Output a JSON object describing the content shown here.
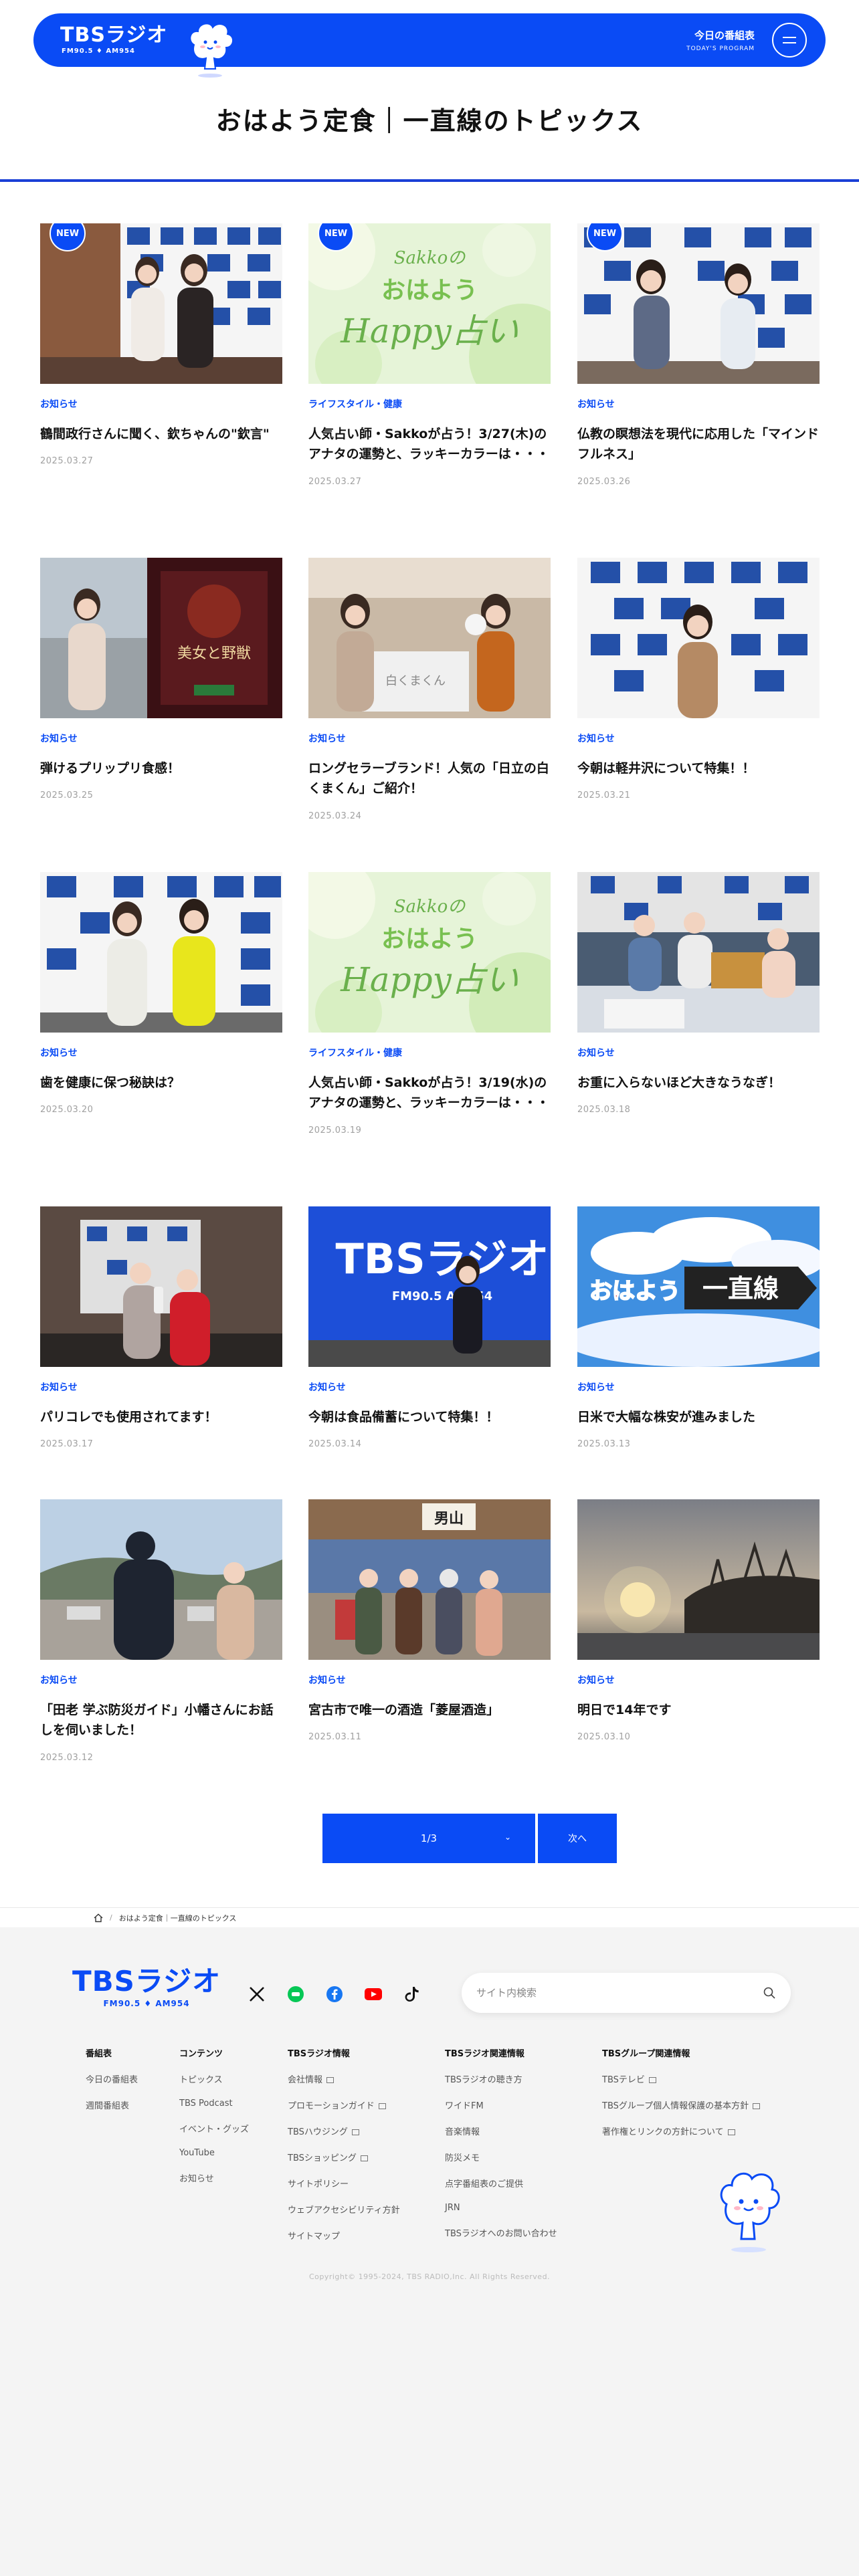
{
  "header": {
    "logo_text": "TBSラジオ",
    "logo_sub": "FM90.5 ♦ AM954",
    "program_label": "今日の番組表",
    "program_sub": "TODAY'S PROGRAM",
    "menu_icon": "hamburger-menu-icon"
  },
  "page": {
    "title": "おはよう定食｜一直線のトピックス"
  },
  "cards": [
    {
      "category": "お知らせ",
      "title": "鶴間政行さんに聞く、欽ちゃんの\"欽言\"",
      "date": "2025.03.27",
      "badge": "NEW"
    },
    {
      "category": "ライフスタイル・健康",
      "title": "人気占い師・Sakkoが占う！3/27(木)のアナタの運勢と、ラッキーカラーは・・・",
      "date": "2025.03.27",
      "badge": "NEW",
      "image_text_top": "Sakkoの",
      "image_text_mid": "おはよう",
      "image_text_bottom": "Happy占い"
    },
    {
      "category": "お知らせ",
      "title": "仏教の瞑想法を現代に応用した「マインドフルネス」",
      "date": "2025.03.26",
      "badge": "NEW"
    },
    {
      "category": "お知らせ",
      "title": "弾けるプリップリ食感！",
      "date": "2025.03.25",
      "image_text": "美女と野獣"
    },
    {
      "category": "お知らせ",
      "title": "ロングセラーブランド！人気の「日立の白くまくん」ご紹介！",
      "date": "2025.03.24",
      "image_text": "白くまくん"
    },
    {
      "category": "お知らせ",
      "title": "今朝は軽井沢について特集！！",
      "date": "2025.03.21"
    },
    {
      "category": "お知らせ",
      "title": "歯を健康に保つ秘訣は？",
      "date": "2025.03.20"
    },
    {
      "category": "ライフスタイル・健康",
      "title": "人気占い師・Sakkoが占う！3/19(水)のアナタの運勢と、ラッキーカラーは・・・",
      "date": "2025.03.19",
      "image_text_top": "Sakkoの",
      "image_text_mid": "おはよう",
      "image_text_bottom": "Happy占い"
    },
    {
      "category": "お知らせ",
      "title": "お重に入らないほど大きなうなぎ！",
      "date": "2025.03.18"
    },
    {
      "category": "お知らせ",
      "title": "パリコレでも使用されてます！",
      "date": "2025.03.17"
    },
    {
      "category": "お知らせ",
      "title": "今朝は食品備蓄について特集！！",
      "date": "2025.03.14",
      "image_text": "TBSラジオ",
      "image_text_sub": "FM90.5 AM954"
    },
    {
      "category": "お知らせ",
      "title": "日米で大幅な株安が進みました",
      "date": "2025.03.13",
      "image_text_left": "おはよう",
      "image_text_right": "一直線"
    },
    {
      "category": "お知らせ",
      "title": "「田老 学ぶ防災ガイド」小幡さんにお話しを伺いました！",
      "date": "2025.03.12"
    },
    {
      "category": "お知らせ",
      "title": "宮古市で唯一の酒造「菱屋酒造」",
      "date": "2025.03.11",
      "image_text": "男山"
    },
    {
      "category": "お知らせ",
      "title": "明日で14年です",
      "date": "2025.03.10"
    }
  ],
  "pagination": {
    "current": "1/3",
    "next_label": "次へ",
    "chevron_icon": "chevron-down-icon"
  },
  "breadcrumb": {
    "home_icon": "home-icon",
    "current": "おはよう定食｜一直線のトピックス"
  },
  "footer": {
    "logo_text": "TBSラジオ",
    "logo_sub": "FM90.5 ♦ AM954",
    "search_placeholder": "サイト内検索",
    "columns": [
      {
        "heading": "番組表",
        "links": [
          "今日の番組表",
          "週間番組表"
        ]
      },
      {
        "heading": "コンテンツ",
        "links": [
          "トピックス",
          "TBS Podcast",
          "イベント・グッズ",
          "YouTube",
          "お知らせ"
        ]
      },
      {
        "heading": "TBSラジオ情報",
        "links": [
          "会社情報",
          "プロモーションガイド",
          "TBSハウジング",
          "TBSショッピング",
          "サイトポリシー",
          "ウェブアクセシビリティ方針",
          "サイトマップ"
        ]
      },
      {
        "heading": "TBSラジオ関連情報",
        "links": [
          "TBSラジオの聴き方",
          "ワイドFM",
          "音楽情報",
          "防災メモ",
          "点字番組表のご提供",
          "JRN",
          "TBSラジオへのお問い合わせ"
        ]
      },
      {
        "heading": "TBSグループ関連情報",
        "links": [
          "TBSテレビ",
          "TBSグループ個人情報保護の基本方針",
          "著作権とリンクの方針について"
        ]
      }
    ],
    "copyright": "Copyright© 1995-2024, TBS RADIO,Inc. All Rights Reserved."
  },
  "colors": {
    "brand_blue": "#0a4bf5",
    "title_rule": "#1a3fd6",
    "date_gray": "#a0a0a0",
    "footer_bg": "#f4f4f4"
  }
}
